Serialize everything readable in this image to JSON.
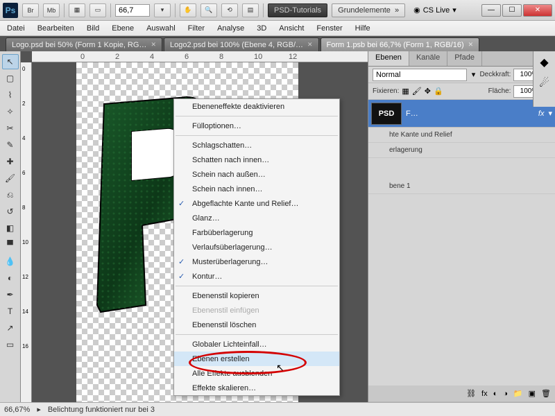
{
  "titlebar": {
    "logo": "Ps",
    "br": "Br",
    "mb": "Mb",
    "zoom": "66,7",
    "nav1": "PSD-Tutorials",
    "nav2": "Grundelemente",
    "cslive": "CS Live"
  },
  "menu": [
    "Datei",
    "Bearbeiten",
    "Bild",
    "Ebene",
    "Auswahl",
    "Filter",
    "Analyse",
    "3D",
    "Ansicht",
    "Fenster",
    "Hilfe"
  ],
  "tabs": [
    "Logo.psd bei 50% (Form 1 Kopie, RG…",
    "Logo2.psd bei 100% (Ebene 4, RGB/…",
    "Form 1.psb bei 66,7% (Form 1, RGB/16)"
  ],
  "panel": {
    "tabs": [
      "Ebenen",
      "Kanäle",
      "Pfade"
    ],
    "blend": "Normal",
    "opacity_lbl": "Deckkraft:",
    "opacity": "100%",
    "lock_lbl": "Fixieren:",
    "fill_lbl": "Fläche:",
    "fill": "100%",
    "layer_name": "F…",
    "thumb_text": "PSD",
    "effects": [
      "hte Kante und Relief",
      "erlagerung"
    ],
    "layer2": "bene 1"
  },
  "ruler_h": [
    "0",
    "2",
    "4",
    "6",
    "8",
    "10",
    "12"
  ],
  "ruler_v": [
    "0",
    "2",
    "4",
    "6",
    "8",
    "10",
    "12",
    "14",
    "16"
  ],
  "context": [
    {
      "t": "Ebeneneffekte deaktivieren"
    },
    {
      "sep": true
    },
    {
      "t": "Fülloptionen…"
    },
    {
      "sep": true
    },
    {
      "t": "Schlagschatten…"
    },
    {
      "t": "Schatten nach innen…"
    },
    {
      "t": "Schein nach außen…"
    },
    {
      "t": "Schein nach innen…"
    },
    {
      "t": "Abgeflachte Kante und Relief…",
      "chk": true
    },
    {
      "t": "Glanz…"
    },
    {
      "t": "Farbüberlagerung"
    },
    {
      "t": "Verlaufsüberlagerung…"
    },
    {
      "t": "Musterüberlagerung…",
      "chk": true
    },
    {
      "t": "Kontur…",
      "chk": true
    },
    {
      "sep": true
    },
    {
      "t": "Ebenenstil kopieren"
    },
    {
      "t": "Ebenenstil einfügen",
      "dis": true
    },
    {
      "t": "Ebenenstil löschen"
    },
    {
      "sep": true
    },
    {
      "t": "Globaler Lichteinfall…"
    },
    {
      "t": "Ebenen erstellen",
      "hover": true
    },
    {
      "t": "Alle Effekte ausblenden"
    },
    {
      "t": "Effekte skalieren…"
    }
  ],
  "status": {
    "zoom": "66,67%",
    "msg": "Belichtung funktioniert nur bei 3"
  }
}
